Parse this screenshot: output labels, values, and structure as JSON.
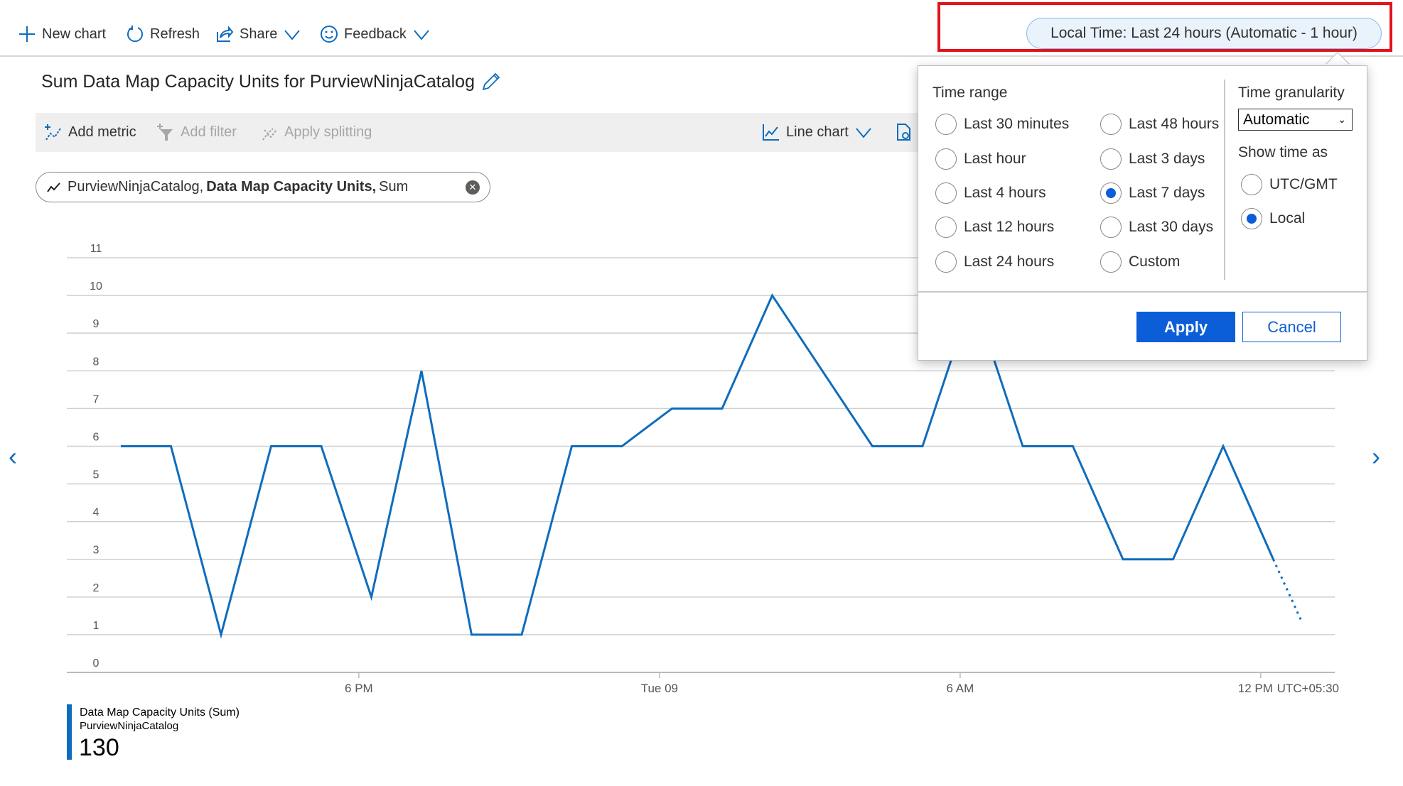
{
  "toolbar": {
    "new_chart": "New chart",
    "refresh": "Refresh",
    "share": "Share",
    "feedback": "Feedback",
    "time_range_button": "Local Time: Last 24 hours (Automatic - 1 hour)"
  },
  "chart_title": "Sum Data Map Capacity Units for PurviewNinjaCatalog",
  "chart_toolbar": {
    "add_metric": "Add metric",
    "add_filter": "Add filter",
    "apply_splitting": "Apply splitting",
    "chart_type": "Line chart"
  },
  "metric_pill": {
    "resource": "PurviewNinjaCatalog,",
    "metric": "Data Map Capacity Units,",
    "aggregation": "Sum"
  },
  "legend": {
    "series": "Data Map Capacity Units (Sum)",
    "resource": "PurviewNinjaCatalog",
    "total": "130"
  },
  "colors": {
    "accent": "#0f6cbd",
    "highlight_box": "#e3131b",
    "apply_button": "#0b5ed7"
  },
  "chart_data": {
    "type": "line",
    "y_ticks": [
      "0",
      "1",
      "2",
      "3",
      "4",
      "5",
      "6",
      "7",
      "8",
      "9",
      "10",
      "11"
    ],
    "ylim": [
      0,
      11
    ],
    "grid": true,
    "x_ticks": [
      {
        "label": "6 PM",
        "x": "18:00"
      },
      {
        "label": "Tue 09",
        "x": "00:00"
      },
      {
        "label": "6 AM",
        "x": "06:00"
      },
      {
        "label": "12 PM",
        "x": "12:00"
      }
    ],
    "timezone_label": "UTC+05:30",
    "series": [
      {
        "x": [
          "13:15",
          "14:15",
          "15:15",
          "16:15",
          "17:15",
          "18:15",
          "19:15",
          "20:15",
          "21:15",
          "22:15",
          "23:15",
          "00:15",
          "01:15",
          "02:15",
          "03:15",
          "04:15",
          "05:15",
          "06:15",
          "07:15",
          "08:15",
          "09:15",
          "10:15",
          "11:15",
          "12:15"
        ],
        "values": [
          6,
          6,
          1,
          6,
          6,
          2,
          8,
          1,
          1,
          6,
          6,
          7,
          7,
          10,
          8,
          6,
          6,
          10,
          6,
          6,
          3,
          3,
          6,
          3
        ],
        "incomplete": {
          "x": "12:50",
          "value": 1.3
        }
      }
    ]
  },
  "time_picker": {
    "time_range_label": "Time range",
    "options": [
      {
        "label": "Last 30 minutes",
        "selected": false
      },
      {
        "label": "Last hour",
        "selected": false
      },
      {
        "label": "Last 4 hours",
        "selected": false
      },
      {
        "label": "Last 12 hours",
        "selected": false
      },
      {
        "label": "Last 24 hours",
        "selected": false
      },
      {
        "label": "Last 48 hours",
        "selected": false
      },
      {
        "label": "Last 3 days",
        "selected": false
      },
      {
        "label": "Last 7 days",
        "selected": true
      },
      {
        "label": "Last 30 days",
        "selected": false
      },
      {
        "label": "Custom",
        "selected": false
      }
    ],
    "granularity_label": "Time granularity",
    "granularity_value": "Automatic",
    "show_time_as_label": "Show time as",
    "show_time_options": [
      {
        "label": "UTC/GMT",
        "selected": false
      },
      {
        "label": "Local",
        "selected": true
      }
    ],
    "apply": "Apply",
    "cancel": "Cancel"
  }
}
